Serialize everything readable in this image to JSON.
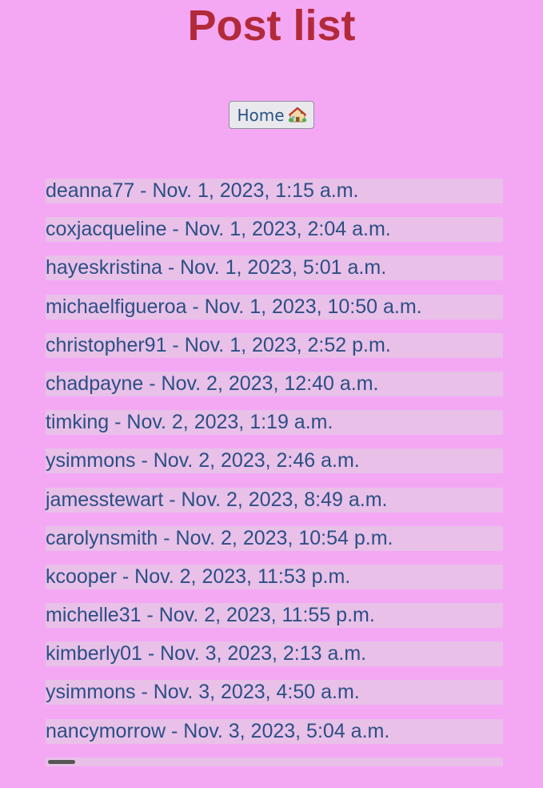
{
  "header": {
    "title": "Post list"
  },
  "nav": {
    "home_label": "Home",
    "home_icon": "house-icon"
  },
  "colors": {
    "background": "#f4a8f4",
    "title": "#b22a3a",
    "item_text": "#2b4f84",
    "item_background": "#e8c0e8"
  },
  "posts": [
    {
      "text": "deanna77 - Nov. 1, 2023, 1:15 a.m."
    },
    {
      "text": "coxjacqueline - Nov. 1, 2023, 2:04 a.m."
    },
    {
      "text": "hayeskristina - Nov. 1, 2023, 5:01 a.m."
    },
    {
      "text": "michaelfigueroa - Nov. 1, 2023, 10:50 a.m."
    },
    {
      "text": "christopher91 - Nov. 1, 2023, 2:52 p.m."
    },
    {
      "text": "chadpayne - Nov. 2, 2023, 12:40 a.m."
    },
    {
      "text": "timking - Nov. 2, 2023, 1:19 a.m."
    },
    {
      "text": "ysimmons - Nov. 2, 2023, 2:46 a.m."
    },
    {
      "text": "jamesstewart - Nov. 2, 2023, 8:49 a.m."
    },
    {
      "text": "carolynsmith - Nov. 2, 2023, 10:54 p.m."
    },
    {
      "text": "kcooper - Nov. 2, 2023, 11:53 p.m."
    },
    {
      "text": "michelle31 - Nov. 2, 2023, 11:55 p.m."
    },
    {
      "text": "kimberly01 - Nov. 3, 2023, 2:13 a.m."
    },
    {
      "text": "ysimmons - Nov. 3, 2023, 4:50 a.m."
    },
    {
      "text": "nancymorrow - Nov. 3, 2023, 5:04 a.m."
    }
  ]
}
